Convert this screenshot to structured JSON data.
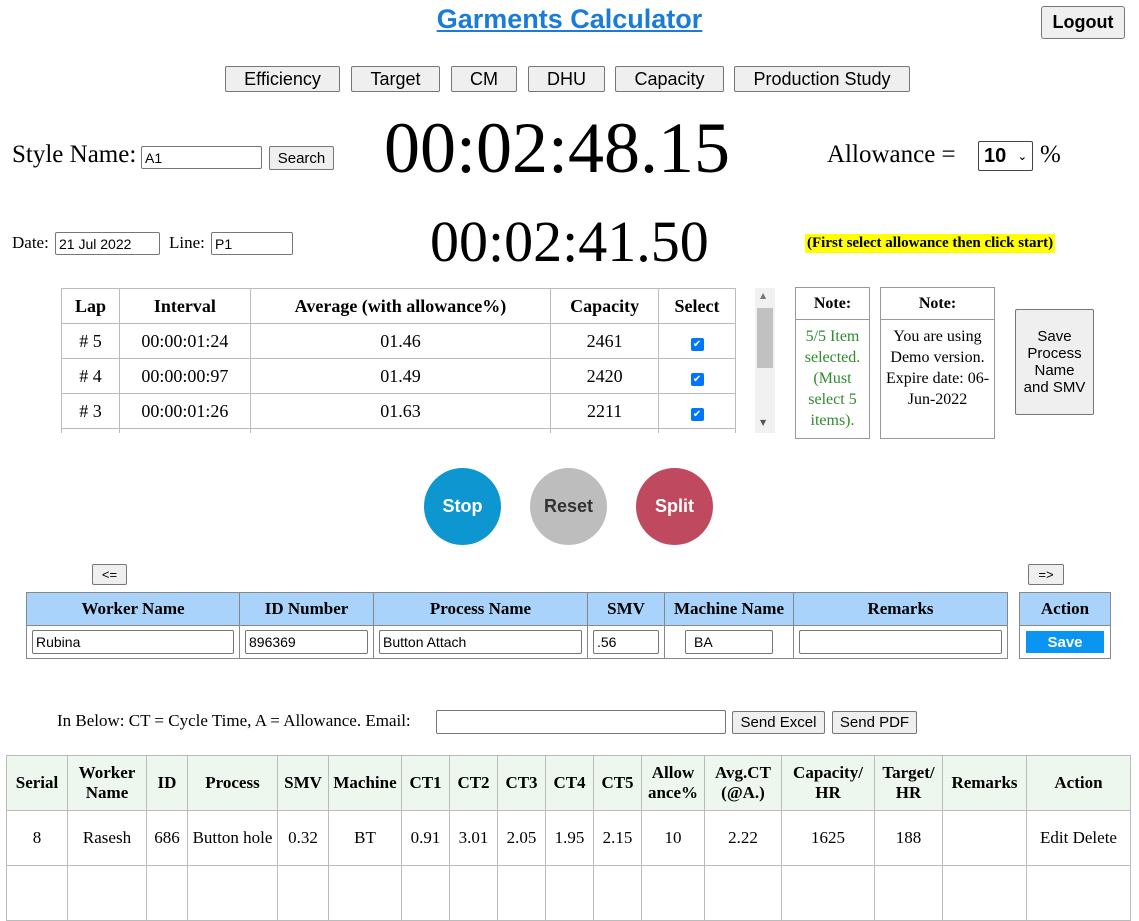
{
  "header": {
    "title": "Garments Calculator",
    "logout_label": "Logout"
  },
  "nav": {
    "tabs": [
      "Efficiency",
      "Target",
      "CM",
      "DHU",
      "Capacity",
      "Production Study"
    ]
  },
  "style": {
    "label": "Style Name:",
    "value": "A1",
    "search_label": "Search"
  },
  "timer": {
    "main": "00:02:48.15",
    "lap": "00:02:41.50"
  },
  "allowance": {
    "label": "Allowance =",
    "value": "10",
    "unit": "%"
  },
  "date": {
    "label": "Date:",
    "value": "21 Jul 2022"
  },
  "line": {
    "label": "Line:",
    "value": "P1"
  },
  "hint": "(First select allowance then click start)",
  "laps": {
    "headers": [
      "Lap",
      "Interval",
      "Average (with allowance%)",
      "Capacity",
      "Select"
    ],
    "rows": [
      {
        "lap": "# 5",
        "interval": "00:00:01:24",
        "average": "01.46",
        "capacity": "2461"
      },
      {
        "lap": "# 4",
        "interval": "00:00:00:97",
        "average": "01.49",
        "capacity": "2420"
      },
      {
        "lap": "# 3",
        "interval": "00:00:01:26",
        "average": "01.63",
        "capacity": "2211"
      }
    ]
  },
  "note1": {
    "head": "Note:",
    "body": "5/5 Item selected. (Must select 5 items)."
  },
  "note2": {
    "head": "Note:",
    "body": "You are using Demo version. Expire date: 06-Jun-2022"
  },
  "save_process_label": "Save Process Name and SMV",
  "controls": {
    "stop": "Stop",
    "reset": "Reset",
    "split": "Split"
  },
  "pager": {
    "prev": "<=",
    "next": "=>"
  },
  "colors": {
    "stop": "#0d96cf",
    "reset": "#bdbdbd",
    "split": "#bf4a5f",
    "save": "#0b95f3",
    "title": "#1a7bd8"
  },
  "worker": {
    "headers": [
      "Worker Name",
      "ID Number",
      "Process Name",
      "SMV",
      "Machine Name",
      "Remarks"
    ],
    "values": {
      "name": "Rubina",
      "id": "896369",
      "process": "Button Attach",
      "smv": ".56",
      "machine": "BA",
      "remarks": ""
    },
    "action_header": "Action",
    "save_label": "Save"
  },
  "email": {
    "label": "In Below: CT = Cycle Time, A = Allowance. Email:",
    "value": "",
    "send_excel": "Send Excel",
    "send_pdf": "Send PDF"
  },
  "records": {
    "headers": [
      "Serial",
      "Worker Name",
      "ID",
      "Process",
      "SMV",
      "Machine",
      "CT1",
      "CT2",
      "CT3",
      "CT4",
      "CT5",
      "Allow ance%",
      "Avg.CT (@A.)",
      "Capacity/ HR",
      "Target/ HR",
      "Remarks",
      "Action"
    ],
    "rows": [
      {
        "serial": "8",
        "worker": "Rasesh",
        "id": "686",
        "process": "Button hole",
        "smv": "0.32",
        "machine": "BT",
        "ct1": "0.91",
        "ct2": "3.01",
        "ct3": "2.05",
        "ct4": "1.95",
        "ct5": "2.15",
        "allowance": "10",
        "avg": "2.22",
        "capacity": "1625",
        "target": "188",
        "remarks": "",
        "edit": "Edit",
        "delete": "Delete"
      }
    ]
  }
}
